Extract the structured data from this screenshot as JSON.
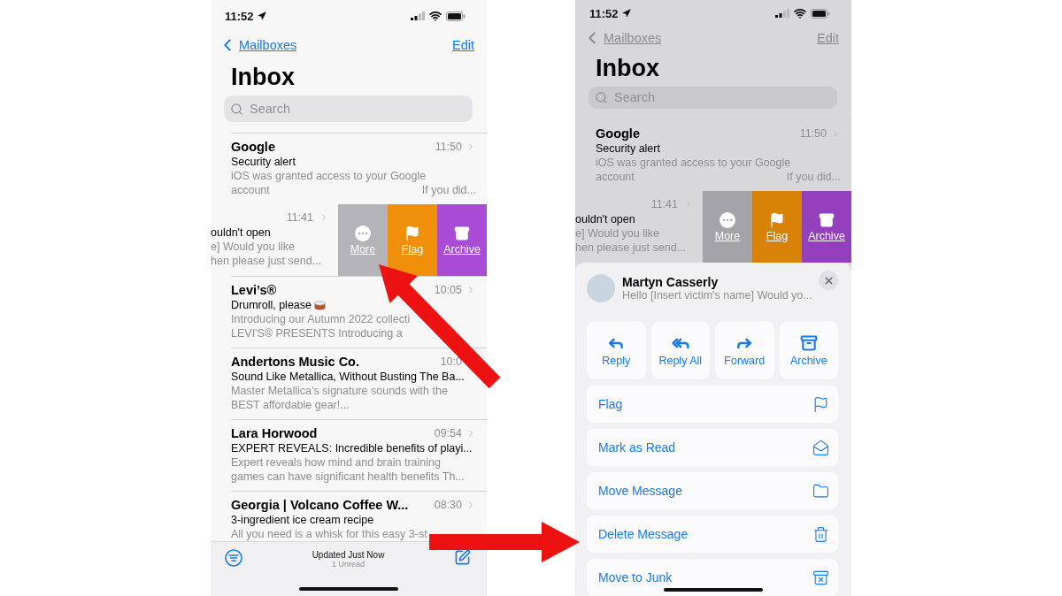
{
  "phones": [
    {
      "dimmed": false,
      "status": {
        "time": "11:52"
      },
      "nav": {
        "back": "Mailboxes",
        "edit": "Edit"
      },
      "title": "Inbox",
      "search": {
        "placeholder": "Search"
      },
      "messages": [
        {
          "kind": "mail",
          "sender": "Google",
          "time": "11:50",
          "subject": "Security alert",
          "preview": [
            "iOS was granted access to your Google",
            "account"
          ],
          "preview_end": "If you did..."
        },
        {
          "kind": "swiped",
          "time": "11:41",
          "subject": "ouldn't open",
          "preview": [
            "e] Would you like",
            "hen please just send..."
          ],
          "actions": [
            {
              "label": "More",
              "color": "#b3b3b8"
            },
            {
              "label": "Flag",
              "color": "#f0900a"
            },
            {
              "label": "Archive",
              "color": "#a94bd6"
            }
          ]
        },
        {
          "kind": "mail",
          "sender": "Levi’s®",
          "time": "10:05",
          "subject": "Drumroll, please",
          "emoji": true,
          "preview": [
            "Introducing our Autumn 2022 collecti",
            "LEVI'S® PRESENTS Introducing a"
          ]
        },
        {
          "kind": "mail",
          "sender": "Andertons Music Co.",
          "time": "10:0",
          "subject": "Sound Like Metallica, Without Busting The Ba...",
          "preview": [
            "Master Metallica's signature sounds with the",
            "BEST affordable gear!..."
          ]
        },
        {
          "kind": "mail",
          "sender": "Lara Horwood",
          "time": "09:54",
          "subject": "EXPERT REVEALS: Incredible benefits of playi...",
          "preview": [
            "Expert reveals how mind and brain training",
            "games can have significant health benefits Th..."
          ]
        },
        {
          "kind": "mail",
          "sender": "Georgia | Volcano Coffee W...",
          "time": "08:30",
          "subject": "3-ingredient ice cream recipe",
          "preview": [
            "All you need is a whisk for this easy 3-st"
          ]
        }
      ],
      "toolbar": {
        "status": "Updated Just Now",
        "unread": "1 Unread"
      }
    },
    {
      "dimmed": true,
      "status": {
        "time": "11:52"
      },
      "nav": {
        "back": "Mailboxes",
        "edit": "Edit"
      },
      "title": "Inbox",
      "search": {
        "placeholder": "Search"
      },
      "messages": [
        {
          "kind": "mail",
          "sender": "Google",
          "time": "11:50",
          "subject": "Security alert",
          "preview": [
            "iOS was granted access to your Google",
            "account"
          ],
          "preview_end": "If you did..."
        },
        {
          "kind": "swiped",
          "time": "11:41",
          "subject": "ouldn't open",
          "preview": [
            "e] Would you like",
            "hen please just send..."
          ],
          "actions": [
            {
              "label": "More",
              "color": "#a3a3a8"
            },
            {
              "label": "Flag",
              "color": "#d98208"
            },
            {
              "label": "Archive",
              "color": "#9440bd"
            }
          ]
        }
      ],
      "sheet": {
        "sender": "Martyn Casserly",
        "preview": "Hello [Insert victim's name] Would yo...",
        "quick_actions": [
          "Reply",
          "Reply All",
          "Forward",
          "Archive"
        ],
        "actions": [
          "Flag",
          "Mark as Read",
          "Move Message",
          "Delete Message",
          "Move to Junk"
        ]
      }
    }
  ]
}
